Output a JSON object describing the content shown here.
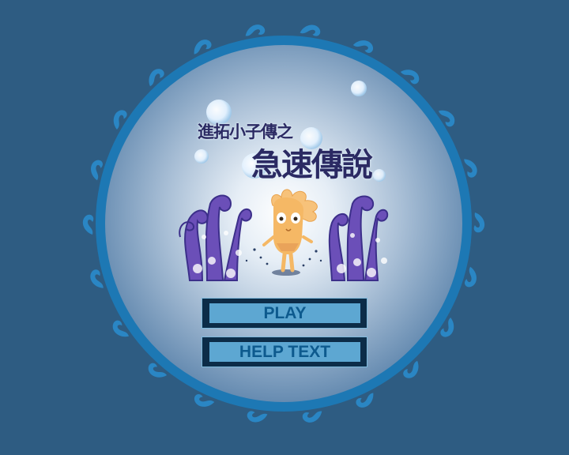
{
  "title": {
    "subtitle": "進拓小子傳之",
    "main": "急速傳說"
  },
  "menu": {
    "play_label": "PLAY",
    "help_label": "HELP TEXT"
  },
  "colors": {
    "background": "#2e5c82",
    "ring": "#1d78b4",
    "title_text": "#2b2a63",
    "button_face": "#5da7d2",
    "button_text": "#0d5a8e",
    "coral": "#6b4fb8",
    "character": "#f5b865"
  },
  "icons": [
    "bubble-icon",
    "coral-icon",
    "character-icon"
  ]
}
